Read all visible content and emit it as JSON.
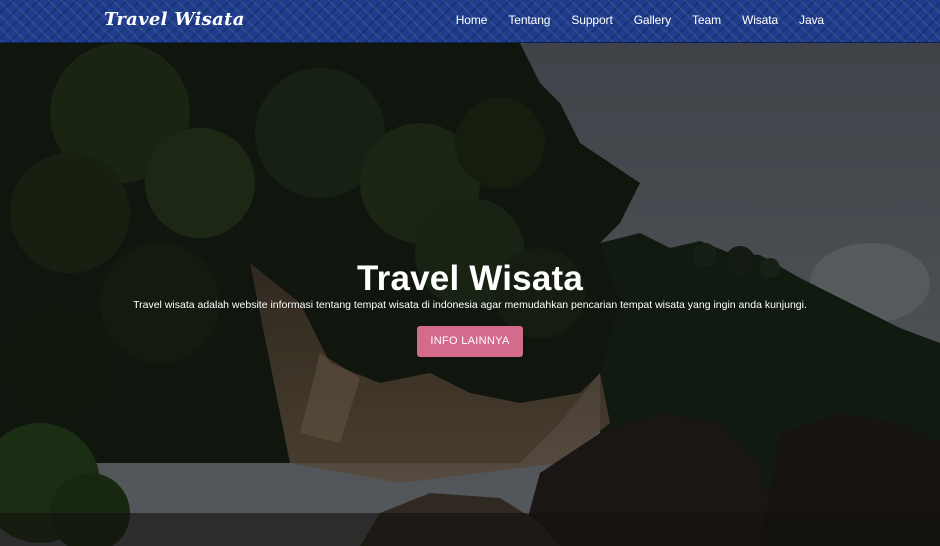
{
  "navbar": {
    "brand": "Travel Wisata",
    "links": [
      "Home",
      "Tentang",
      "Support",
      "Gallery",
      "Team",
      "Wisata",
      "Java"
    ]
  },
  "hero": {
    "title": "Travel Wisata",
    "description": "Travel wisata adalah website informasi tentang tempat wisata di indonesia agar memudahkan pencarian tempat wisata yang ingin anda kunjungi.",
    "button_label": "INFO LAINNYA"
  },
  "colors": {
    "navbar_bg": "#1f3d8c",
    "button_bg": "#d46b8c"
  }
}
